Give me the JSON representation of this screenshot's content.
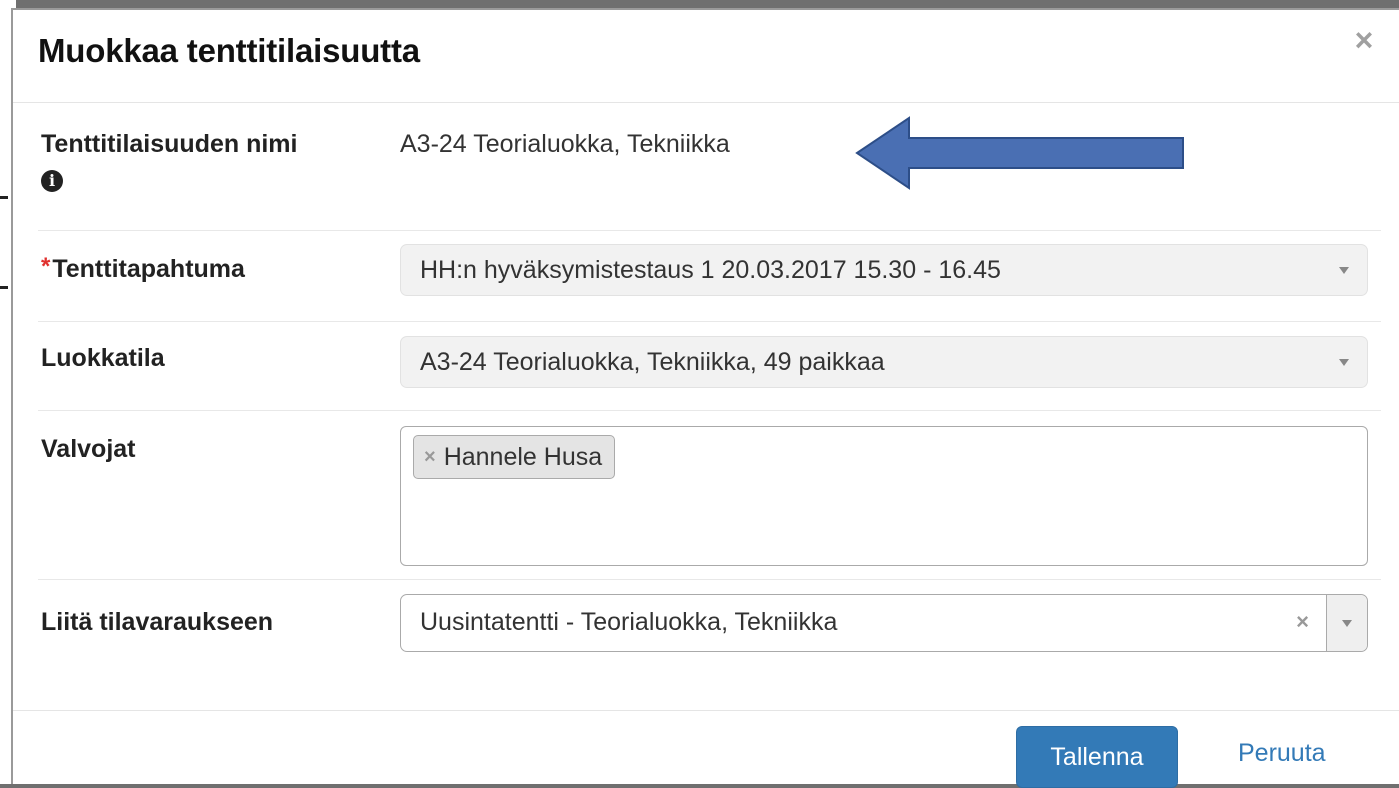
{
  "modal": {
    "title": "Muokkaa tenttitilaisuutta",
    "close_icon": "×"
  },
  "fields": {
    "name": {
      "label": "Tenttitilaisuuden nimi",
      "value": "A3-24 Teorialuokka, Tekniikka",
      "info_icon": "info-icon"
    },
    "event": {
      "required_marker": "*",
      "label": "Tenttitapahtuma",
      "value": "HH:n hyväksymistestaus 1 20.03.2017 15.30 - 16.45"
    },
    "room": {
      "label": "Luokkatila",
      "value": "A3-24 Teorialuokka, Tekniikka, 49 paikkaa"
    },
    "supervisors": {
      "label": "Valvojat",
      "tags": [
        {
          "remove": "×",
          "name": "Hannele Husa"
        }
      ]
    },
    "reservation": {
      "label": "Liitä tilavaraukseen",
      "value": "Uusintatentti - Teorialuokka, Tekniikka",
      "clear": "×"
    }
  },
  "footer": {
    "save_label": "Tallenna",
    "cancel_label": "Peruuta"
  },
  "colors": {
    "primary": "#337ab7",
    "required": "#e0312f",
    "annotation_arrow": "#4a6fb3"
  }
}
